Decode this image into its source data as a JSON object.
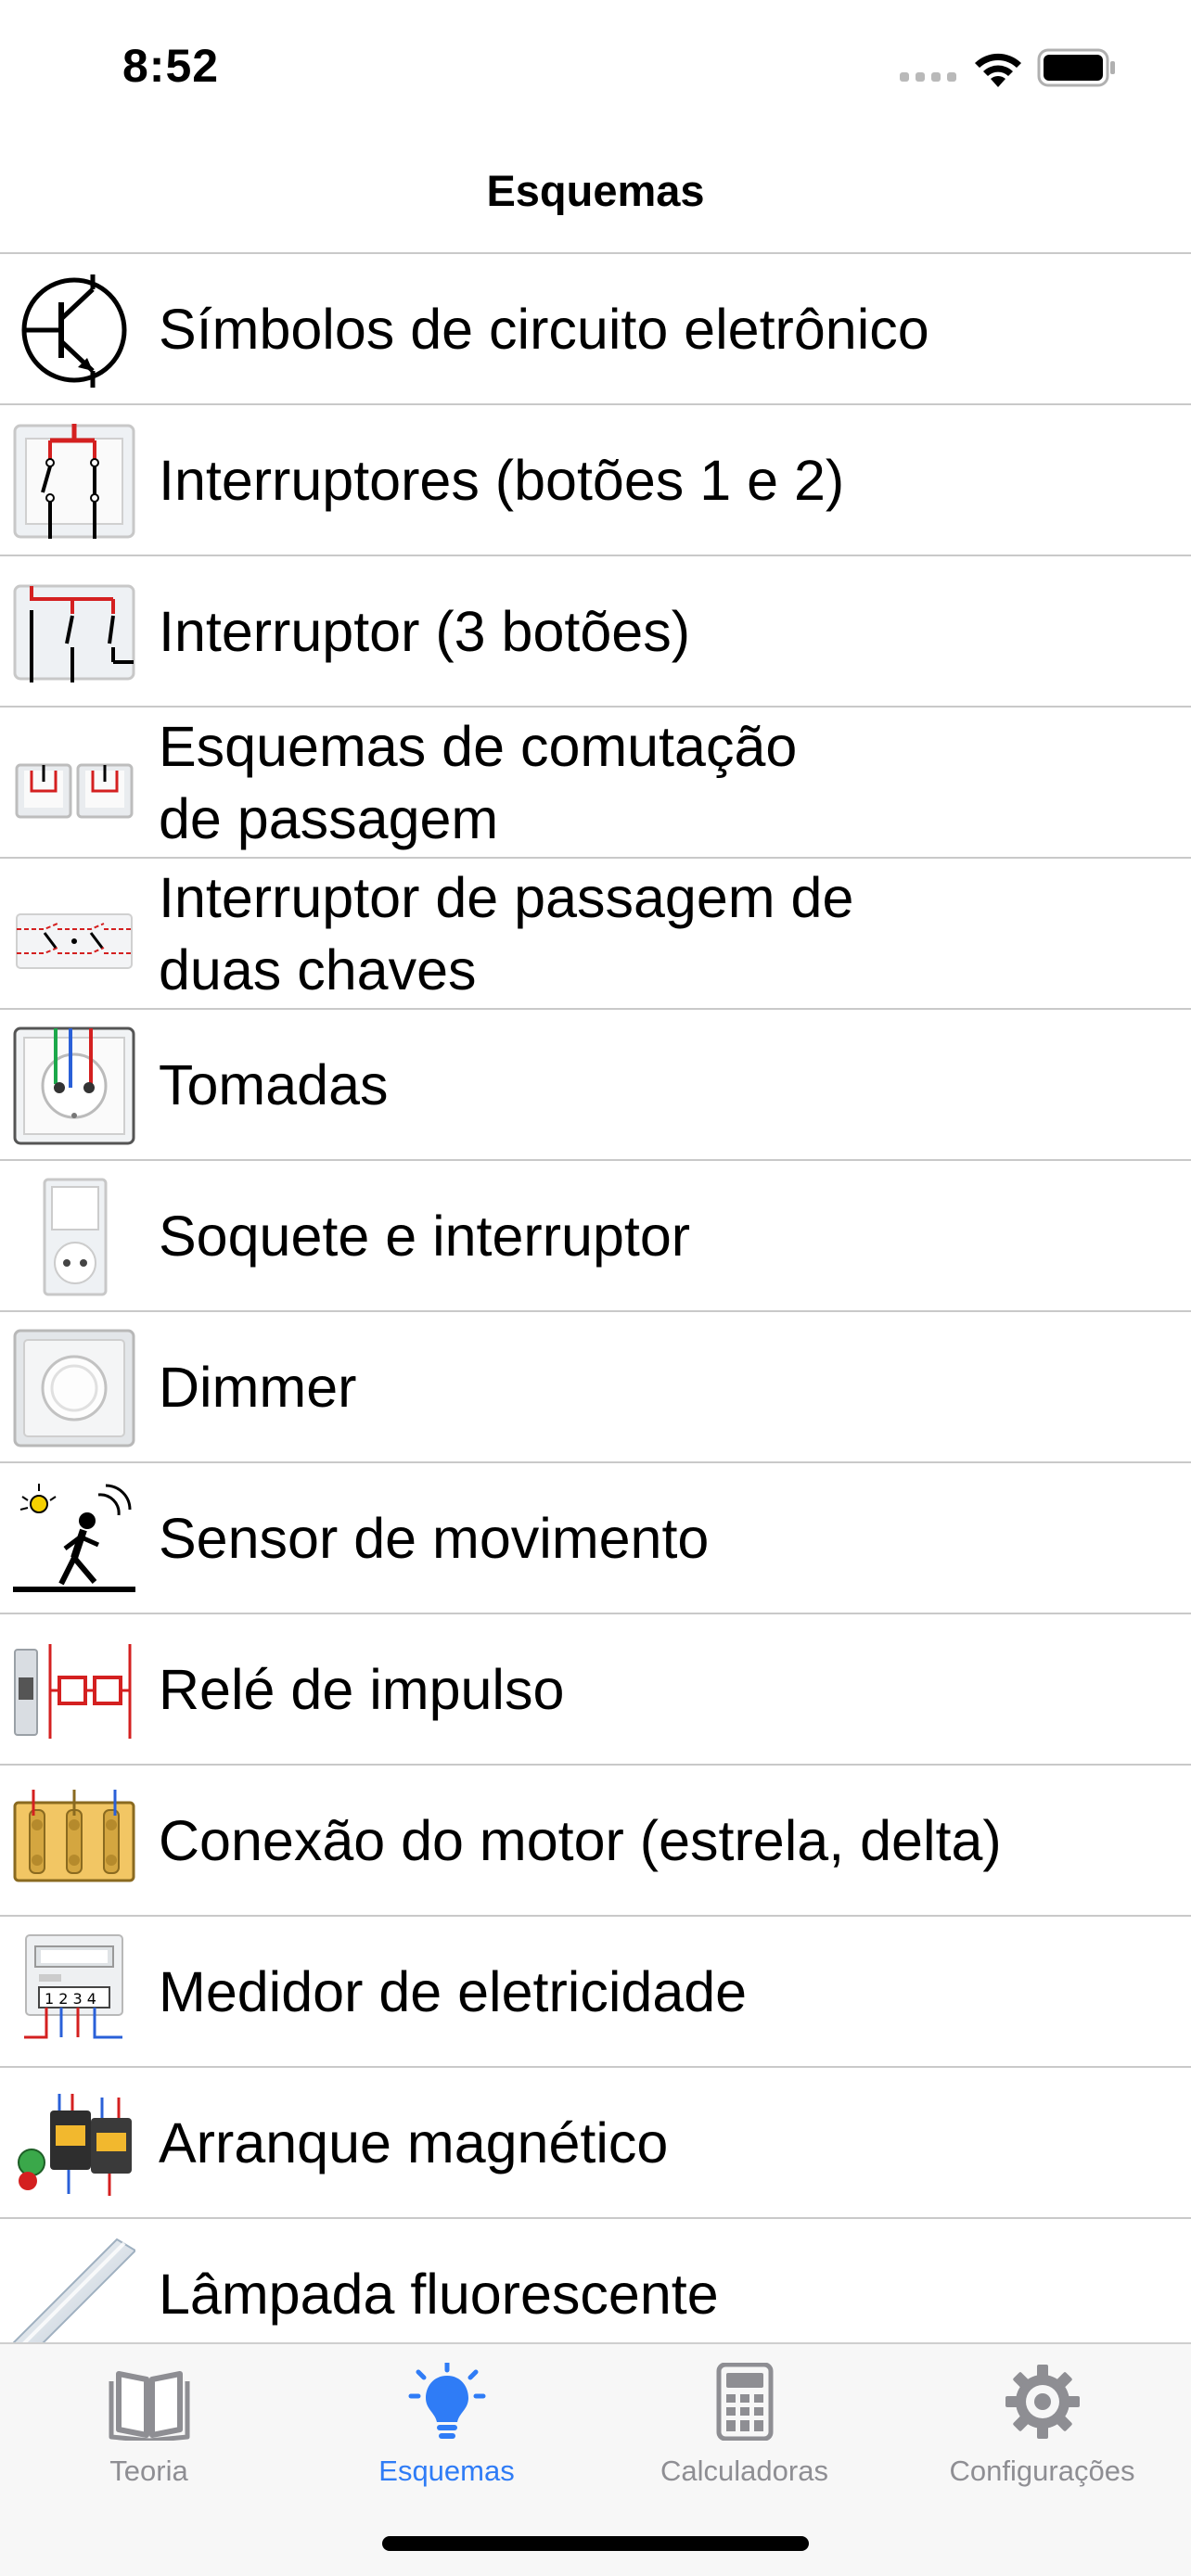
{
  "status_bar": {
    "time": "8:52"
  },
  "nav": {
    "title": "Esquemas"
  },
  "list": {
    "items": [
      {
        "label": "Símbolos de circuito eletrônico",
        "icon": "transistor-symbol-icon"
      },
      {
        "label": "Interruptores (botões 1 e 2)",
        "icon": "switch-two-buttons-icon"
      },
      {
        "label": "Interruptor (3 botões)",
        "icon": "switch-three-buttons-icon"
      },
      {
        "label": "Esquemas de comutação\nde passagem",
        "icon": "pass-through-switch-icon"
      },
      {
        "label": "Interruptor de passagem de\nduas chaves",
        "icon": "double-pass-switch-icon"
      },
      {
        "label": "Tomadas",
        "icon": "socket-icon"
      },
      {
        "label": "Soquete e interruptor",
        "icon": "socket-switch-icon"
      },
      {
        "label": "Dimmer",
        "icon": "dimmer-icon"
      },
      {
        "label": "Sensor de movimento",
        "icon": "motion-sensor-icon"
      },
      {
        "label": "Relé de impulso",
        "icon": "impulse-relay-icon"
      },
      {
        "label": "Conexão do motor (estrela, delta)",
        "icon": "motor-connection-icon"
      },
      {
        "label": "Medidor de eletricidade",
        "icon": "electricity-meter-icon"
      },
      {
        "label": "Arranque magnético",
        "icon": "magnetic-starter-icon"
      },
      {
        "label": "Lâmpada fluorescente",
        "icon": "fluorescent-lamp-icon"
      }
    ]
  },
  "tabs": [
    {
      "label": "Teoria",
      "icon": "book-icon",
      "active": false
    },
    {
      "label": "Esquemas",
      "icon": "lightbulb-icon",
      "active": true
    },
    {
      "label": "Calculadoras",
      "icon": "calculator-icon",
      "active": false
    },
    {
      "label": "Configurações",
      "icon": "gear-icon",
      "active": false
    }
  ],
  "colors": {
    "accent": "#2f7cf6",
    "inactive": "#8e8e93",
    "separator": "#c9c9c9"
  }
}
